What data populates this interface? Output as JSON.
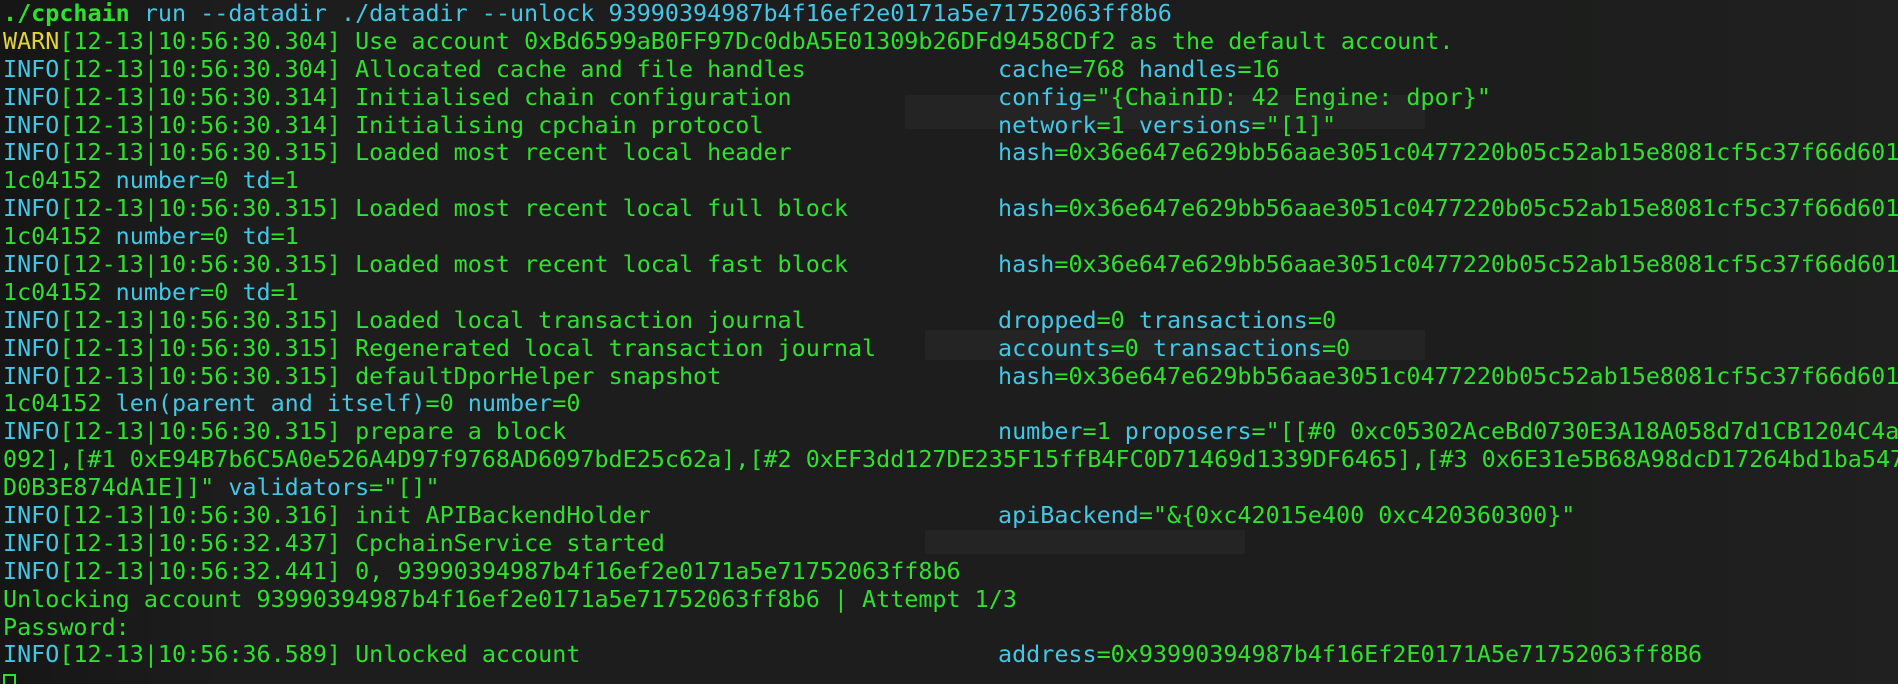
{
  "terminal": {
    "command": {
      "program": "./cpchain",
      "args": " run --datadir ./datadir --unlock 93990394987b4f16ef2e0171a5e71752063ff8b6"
    },
    "lines": [
      {
        "level": "WARN",
        "time": "[12-13|10:56:30.304]",
        "msg": " Use account 0xBd6599aB0FF97Dc0dbA5E01309b26DFd9458CDf2 as the default account."
      },
      {
        "level": "INFO",
        "time": "[12-13|10:56:30.304]",
        "msg": " Allocated cache and file handles",
        "ctx": [
          {
            "k": "cache",
            "v": "768"
          },
          {
            "k": "handles",
            "v": "16"
          }
        ]
      },
      {
        "level": "INFO",
        "time": "[12-13|10:56:30.314]",
        "msg": " Initialised chain configuration",
        "ctx": [
          {
            "k": "config",
            "v": "\"{ChainID: 42 Engine: dpor}\""
          }
        ]
      },
      {
        "level": "INFO",
        "time": "[12-13|10:56:30.314]",
        "msg": " Initialising cpchain protocol",
        "ctx": [
          {
            "k": "network",
            "v": "1"
          },
          {
            "k": "versions",
            "v": "\"[1]\""
          }
        ]
      },
      {
        "level": "INFO",
        "time": "[12-13|10:56:30.315]",
        "msg": " Loaded most recent local header",
        "ctx": [
          {
            "k": "hash",
            "v": "0x36e647e629bb56aae3051c0477220b05c52ab15e8081cf5c37f66d601"
          }
        ]
      },
      {
        "cont": [
          {
            "v": "1c04152"
          },
          {
            "k": "number",
            "v": "0"
          },
          {
            "k": "td",
            "v": "1"
          }
        ]
      },
      {
        "level": "INFO",
        "time": "[12-13|10:56:30.315]",
        "msg": " Loaded most recent local full block",
        "ctx": [
          {
            "k": "hash",
            "v": "0x36e647e629bb56aae3051c0477220b05c52ab15e8081cf5c37f66d601"
          }
        ]
      },
      {
        "cont": [
          {
            "v": "1c04152"
          },
          {
            "k": "number",
            "v": "0"
          },
          {
            "k": "td",
            "v": "1"
          }
        ]
      },
      {
        "level": "INFO",
        "time": "[12-13|10:56:30.315]",
        "msg": " Loaded most recent local fast block",
        "ctx": [
          {
            "k": "hash",
            "v": "0x36e647e629bb56aae3051c0477220b05c52ab15e8081cf5c37f66d601"
          }
        ]
      },
      {
        "cont": [
          {
            "v": "1c04152"
          },
          {
            "k": "number",
            "v": "0"
          },
          {
            "k": "td",
            "v": "1"
          }
        ]
      },
      {
        "level": "INFO",
        "time": "[12-13|10:56:30.315]",
        "msg": " Loaded local transaction journal",
        "ctx": [
          {
            "k": "dropped",
            "v": "0"
          },
          {
            "k": "transactions",
            "v": "0"
          }
        ]
      },
      {
        "level": "INFO",
        "time": "[12-13|10:56:30.315]",
        "msg": " Regenerated local transaction journal",
        "ctx": [
          {
            "k": "accounts",
            "v": "0"
          },
          {
            "k": "transactions",
            "v": "0"
          }
        ]
      },
      {
        "level": "INFO",
        "time": "[12-13|10:56:30.315]",
        "msg": " defaultDporHelper snapshot",
        "ctx": [
          {
            "k": "hash",
            "v": "0x36e647e629bb56aae3051c0477220b05c52ab15e8081cf5c37f66d601"
          }
        ]
      },
      {
        "cont": [
          {
            "v": "1c04152"
          },
          {
            "k": "len(parent and itself)",
            "v": "0"
          },
          {
            "k": "number",
            "v": "0"
          }
        ]
      },
      {
        "level": "INFO",
        "time": "[12-13|10:56:30.315]",
        "msg": " prepare a block",
        "ctx": [
          {
            "k": "number",
            "v": "1"
          },
          {
            "k": "proposers",
            "v": "\"[[#0 0xc05302AceBd0730E3A18A058d7d1CB1204C4a"
          }
        ]
      },
      {
        "raw": "092],[#1 0xE94B7b6C5A0e526A4D97f9768AD6097bdE25c62a],[#2 0xEF3dd127DE235F15ffB4FC0D71469d1339DF6465],[#3 0x6E31e5B68A98dcD17264bd1ba547"
      },
      {
        "cont": [
          {
            "v": "D0B3E874dA1E]]\""
          },
          {
            "k": "validators",
            "v": "\"[]\""
          }
        ]
      },
      {
        "level": "INFO",
        "time": "[12-13|10:56:30.316]",
        "msg": " init APIBackendHolder",
        "ctx": [
          {
            "k": "apiBackend",
            "v": "\"&{0xc42015e400 0xc420360300}\""
          }
        ]
      },
      {
        "level": "INFO",
        "time": "[12-13|10:56:32.437]",
        "msg": " CpchainService started"
      },
      {
        "level": "INFO",
        "time": "[12-13|10:56:32.441]",
        "msg": " 0, 93990394987b4f16ef2e0171a5e71752063ff8b6"
      },
      {
        "raw": "Unlocking account 93990394987b4f16ef2e0171a5e71752063ff8b6 | Attempt 1/3"
      },
      {
        "raw": "Password:"
      },
      {
        "level": "INFO",
        "time": "[12-13|10:56:36.589]",
        "msg": " Unlocked account",
        "ctx": [
          {
            "k": "address",
            "v": "0x93990394987b4f16Ef2E0171A5e71752063ff8B6"
          }
        ]
      }
    ]
  },
  "colors": {
    "background": "#1c1d1c",
    "green": "#2fe02f",
    "cyan": "#43c7e6",
    "warn_yellow": "#e3d23a"
  }
}
